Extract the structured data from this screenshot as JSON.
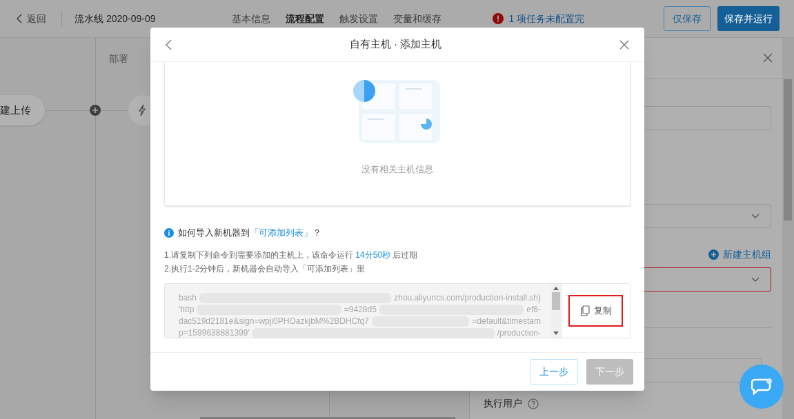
{
  "header": {
    "back": "返回",
    "title": "流水线 2020-09-09",
    "tabs": [
      {
        "label": "基本信息",
        "selected": false
      },
      {
        "label": "流程配置",
        "selected": true
      },
      {
        "label": "触发设置",
        "selected": false
      },
      {
        "label": "变量和缓存",
        "selected": false
      }
    ],
    "warning": "1 项任务未配置完",
    "buttons": [
      {
        "label": "仅保存",
        "kind": "outline"
      },
      {
        "label": "保存并运行",
        "kind": "primary"
      }
    ]
  },
  "canvas": {
    "stage_label": "部署",
    "node_label": "建上传"
  },
  "side_panel": {
    "new_group_link": "新建主机组",
    "user_label": "执行用户"
  },
  "modal": {
    "title": "自有主机 · 添加主机",
    "empty_text": "没有相关主机信息",
    "help": {
      "before": "如何导入新机器到",
      "link": "「可添加列表」",
      "after": "？"
    },
    "step_1": {
      "before": "1.请复制下列命令到需要添加的主机上，该命令运行 ",
      "highlight": "14分50秒",
      "after": " 后过期"
    },
    "step_2": "2.执行1-2分钟后，新机器会自动导入「可添加列表」里",
    "command_lines": [
      [
        {
          "kind": "text",
          "text": "bash"
        },
        {
          "kind": "redacted"
        },
        {
          "kind": "text",
          "text": "zhou.aliyuncs.com/production-install.sh)"
        }
      ],
      [
        {
          "kind": "text",
          "text": "'http"
        },
        {
          "kind": "redacted"
        },
        {
          "kind": "text",
          "text": "=9428d5"
        },
        {
          "kind": "redacted"
        },
        {
          "kind": "text",
          "text": "ef6-"
        }
      ],
      [
        {
          "kind": "text",
          "text": "dac519d2181e&sign=wpji0PHOazkjbM%2BDHCfq7"
        },
        {
          "kind": "redacted"
        },
        {
          "kind": "text",
          "text": "=default&timestam"
        }
      ],
      [
        {
          "kind": "text",
          "text": "p=1599638881399'"
        },
        {
          "kind": "redacted"
        },
        {
          "kind": "text",
          "text": "/production-"
        }
      ]
    ],
    "copy_button": {
      "label": "复制",
      "annotated": true
    },
    "footer_buttons": [
      {
        "label": "上一步",
        "kind": "outline",
        "disabled": false
      },
      {
        "label": "下一步",
        "kind": "primary",
        "disabled": true
      }
    ]
  }
}
